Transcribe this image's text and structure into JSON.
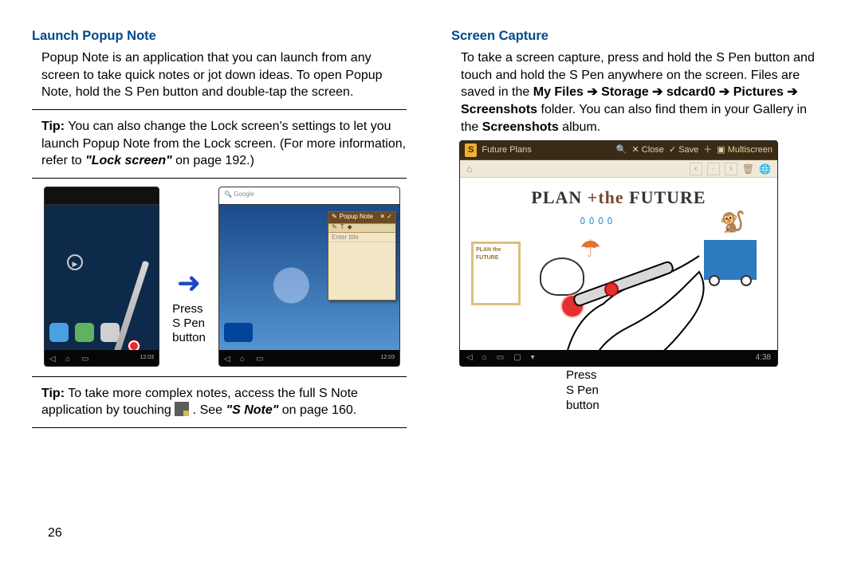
{
  "left": {
    "heading": "Launch Popup Note",
    "intro": "Popup Note is an application that you can launch from any screen to take quick notes or jot down ideas. To open Popup Note, hold the S Pen button and double-tap the screen.",
    "tip1_label": "Tip:",
    "tip1_text": " You can also change the Lock screen's settings to let you launch Popup Note from the Lock screen. (For more information, refer to ",
    "tip1_ref": "\"Lock screen\"",
    "tip1_suffix": " on page 192.)",
    "arrow_label_1": "Press",
    "arrow_label_2": "S Pen",
    "arrow_label_3": "button",
    "tip2_label": "Tip:",
    "tip2_text_a": " To take more complex notes, access the full S Note application by touching ",
    "tip2_text_b": " . See ",
    "tip2_ref": "\"S Note\"",
    "tip2_suffix": " on page 160.)",
    "tip2_page_suffix": " on page 160."
  },
  "right": {
    "heading": "Screen Capture",
    "intro_a": "To take a screen capture, press and hold the S Pen button and touch and hold the S Pen anywhere on the screen. Files are saved in the ",
    "path": "My Files ➔ Storage ➔ sdcard0 ➔ Pictures ➔ Screenshots",
    "intro_b": " folder. You can also find them in your Gallery in the ",
    "album": "Screenshots",
    "intro_c": " album.",
    "caption_1": "Press",
    "caption_2": "S Pen",
    "caption_3": "button"
  },
  "mini1": {
    "clock": "12:03"
  },
  "mini2": {
    "note_title": "Popup Note",
    "enter_title": "Enter title"
  },
  "bigshot": {
    "breadcrumb_icon": "S",
    "breadcrumb": "Future Plans",
    "search": "🔍",
    "close": "✕ Close",
    "save": "✓ Save",
    "multiscreen": "▣ Multiscreen",
    "banner_a": "PLAN",
    "banner_b": "+the",
    "banner_c": "FUTURE",
    "thumb_title": "PLAN the FUTURE",
    "nav_clock": "4:38"
  },
  "page_number": "26"
}
